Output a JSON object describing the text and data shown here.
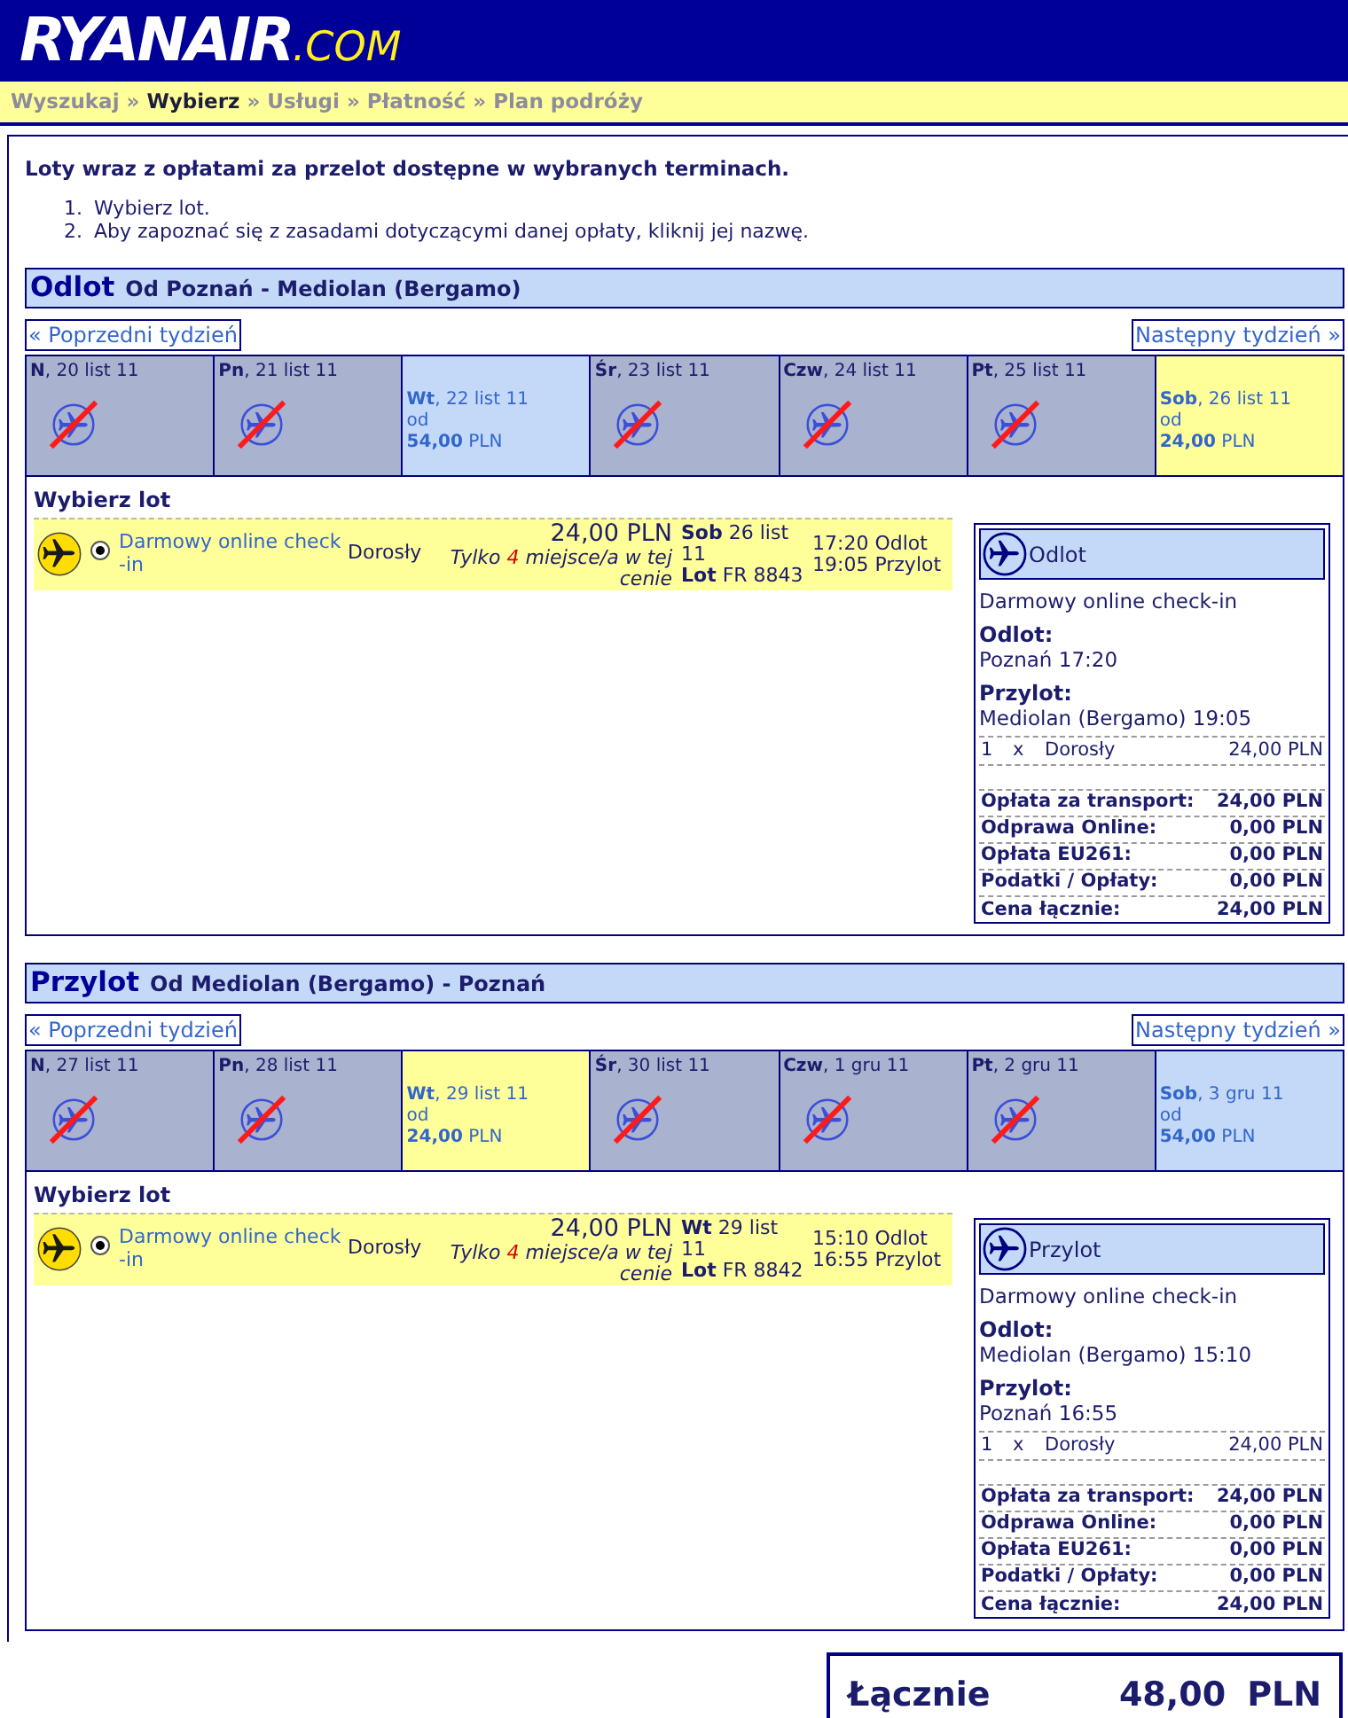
{
  "logo": {
    "name": "RYANAIR",
    "suffix": ".COM"
  },
  "breadcrumb": {
    "steps": [
      {
        "label": "Wyszukaj",
        "selected": false
      },
      {
        "label": "Wybierz",
        "selected": true
      },
      {
        "label": "Usługi",
        "selected": false
      },
      {
        "label": "Płatność",
        "selected": false
      },
      {
        "label": "Plan podróży",
        "selected": false
      }
    ],
    "separators": [
      "»",
      "»",
      "»",
      "»"
    ]
  },
  "intro": {
    "title": "Loty wraz z opłatami za przelot dostępne w wybranych terminach.",
    "steps": [
      {
        "number": "1.",
        "text": "Wybierz lot."
      },
      {
        "number": "2.",
        "text": "Aby zapoznać się z zasadami dotyczącymi danej opłaty, kliknij jej nazwę."
      }
    ]
  },
  "journeys": [
    {
      "heading": "Odlot",
      "route": "Od Poznań - Mediolan (Bergamo)",
      "prev_week": "« Poprzedni tydzień",
      "next_week": "Następny tydzień »",
      "days": [
        {
          "kind": "no_flights",
          "label": "**N**, 20 list 11",
          "selected": false
        },
        {
          "kind": "no_flights",
          "label": "**Pn**, 21 list 11",
          "selected": false
        },
        {
          "kind": "fare",
          "label": "**Wt**, 22 list 11",
          "from": "od",
          "price": "**54,00** PLN",
          "selected": false
        },
        {
          "kind": "no_flights",
          "label": "**Śr**, 23 list 11",
          "selected": false
        },
        {
          "kind": "no_flights",
          "label": "**Czw**, 24 list 11",
          "selected": false
        },
        {
          "kind": "no_flights",
          "label": "**Pt**, 25 list 11",
          "selected": false
        },
        {
          "kind": "fare",
          "label": "**Sob**, 26 list 11",
          "from": "od",
          "price": "**24,00** PLN",
          "selected": true
        }
      ],
      "choose_label": "Wybierz lot",
      "flights": [
        {
          "selected": true,
          "fare_name": "Darmowy online check-in",
          "passenger": "Dorosły",
          "price": "24,00 PLN",
          "seats_note": {
            "before": "Tylko",
            "count": "4",
            "after": "miejsce/a w tej cenie"
          },
          "date": "**Sob** 26 list 11",
          "flight": "**Lot** FR 8843",
          "times": [
            "17:20 Odlot",
            "19:05 Przylot"
          ]
        }
      ],
      "summary": {
        "title": "Odlot",
        "fare_name": "Darmowy online check-in",
        "legs": [
          {
            "label": "Odlot:",
            "value": "Poznań 17:20"
          },
          {
            "label": "Przylot:",
            "value": "Mediolan (Bergamo) 19:05"
          }
        ],
        "passenger_line": {
          "qty": "1",
          "times": "x",
          "type": "Dorosły",
          "amount": "24,00 PLN"
        },
        "fees": [
          {
            "label": "Opłata za transport:",
            "amount": "24,00 PLN"
          },
          {
            "label": "Odprawa Online:",
            "amount": "0,00 PLN"
          },
          {
            "label": "Opłata EU261:",
            "amount": "0,00 PLN"
          },
          {
            "label": "Podatki / Opłaty:",
            "amount": "0,00 PLN"
          },
          {
            "label": "Cena łącznie:",
            "amount": "24,00 PLN"
          }
        ]
      }
    },
    {
      "heading": "Przylot",
      "route": "Od Mediolan (Bergamo) - Poznań",
      "prev_week": "« Poprzedni tydzień",
      "next_week": "Następny tydzień »",
      "days": [
        {
          "kind": "no_flights",
          "label": "**N**, 27 list 11",
          "selected": false
        },
        {
          "kind": "no_flights",
          "label": "**Pn**, 28 list 11",
          "selected": false
        },
        {
          "kind": "fare",
          "label": "**Wt**, 29 list 11",
          "from": "od",
          "price": "**24,00** PLN",
          "selected": true
        },
        {
          "kind": "no_flights",
          "label": "**Śr**, 30 list 11",
          "selected": false
        },
        {
          "kind": "no_flights",
          "label": "**Czw**, 1 gru 11",
          "selected": false
        },
        {
          "kind": "no_flights",
          "label": "**Pt**, 2 gru 11",
          "selected": false
        },
        {
          "kind": "fare",
          "label": "**Sob**, 3 gru 11",
          "from": "od",
          "price": "**54,00** PLN",
          "selected": false
        }
      ],
      "choose_label": "Wybierz lot",
      "flights": [
        {
          "selected": true,
          "fare_name": "Darmowy online check-in",
          "passenger": "Dorosły",
          "price": "24,00 PLN",
          "seats_note": {
            "before": "Tylko",
            "count": "4",
            "after": "miejsce/a w tej cenie"
          },
          "date": "**Wt** 29 list 11",
          "flight": "**Lot** FR 8842",
          "times": [
            "15:10 Odlot",
            "16:55 Przylot"
          ]
        }
      ],
      "summary": {
        "title": "Przylot",
        "fare_name": "Darmowy online check-in",
        "legs": [
          {
            "label": "Odlot:",
            "value": "Mediolan (Bergamo) 15:10"
          },
          {
            "label": "Przylot:",
            "value": "Poznań 16:55"
          }
        ],
        "passenger_line": {
          "qty": "1",
          "times": "x",
          "type": "Dorosły",
          "amount": "24,00 PLN"
        },
        "fees": [
          {
            "label": "Opłata za transport:",
            "amount": "24,00 PLN"
          },
          {
            "label": "Odprawa Online:",
            "amount": "0,00 PLN"
          },
          {
            "label": "Opłata EU261:",
            "amount": "0,00 PLN"
          },
          {
            "label": "Podatki / Opłaty:",
            "amount": "0,00 PLN"
          },
          {
            "label": "Cena łącznie:",
            "amount": "24,00 PLN"
          }
        ]
      }
    }
  ],
  "total": {
    "label": "Łącznie",
    "amount": "48,00",
    "currency": "PLN"
  }
}
